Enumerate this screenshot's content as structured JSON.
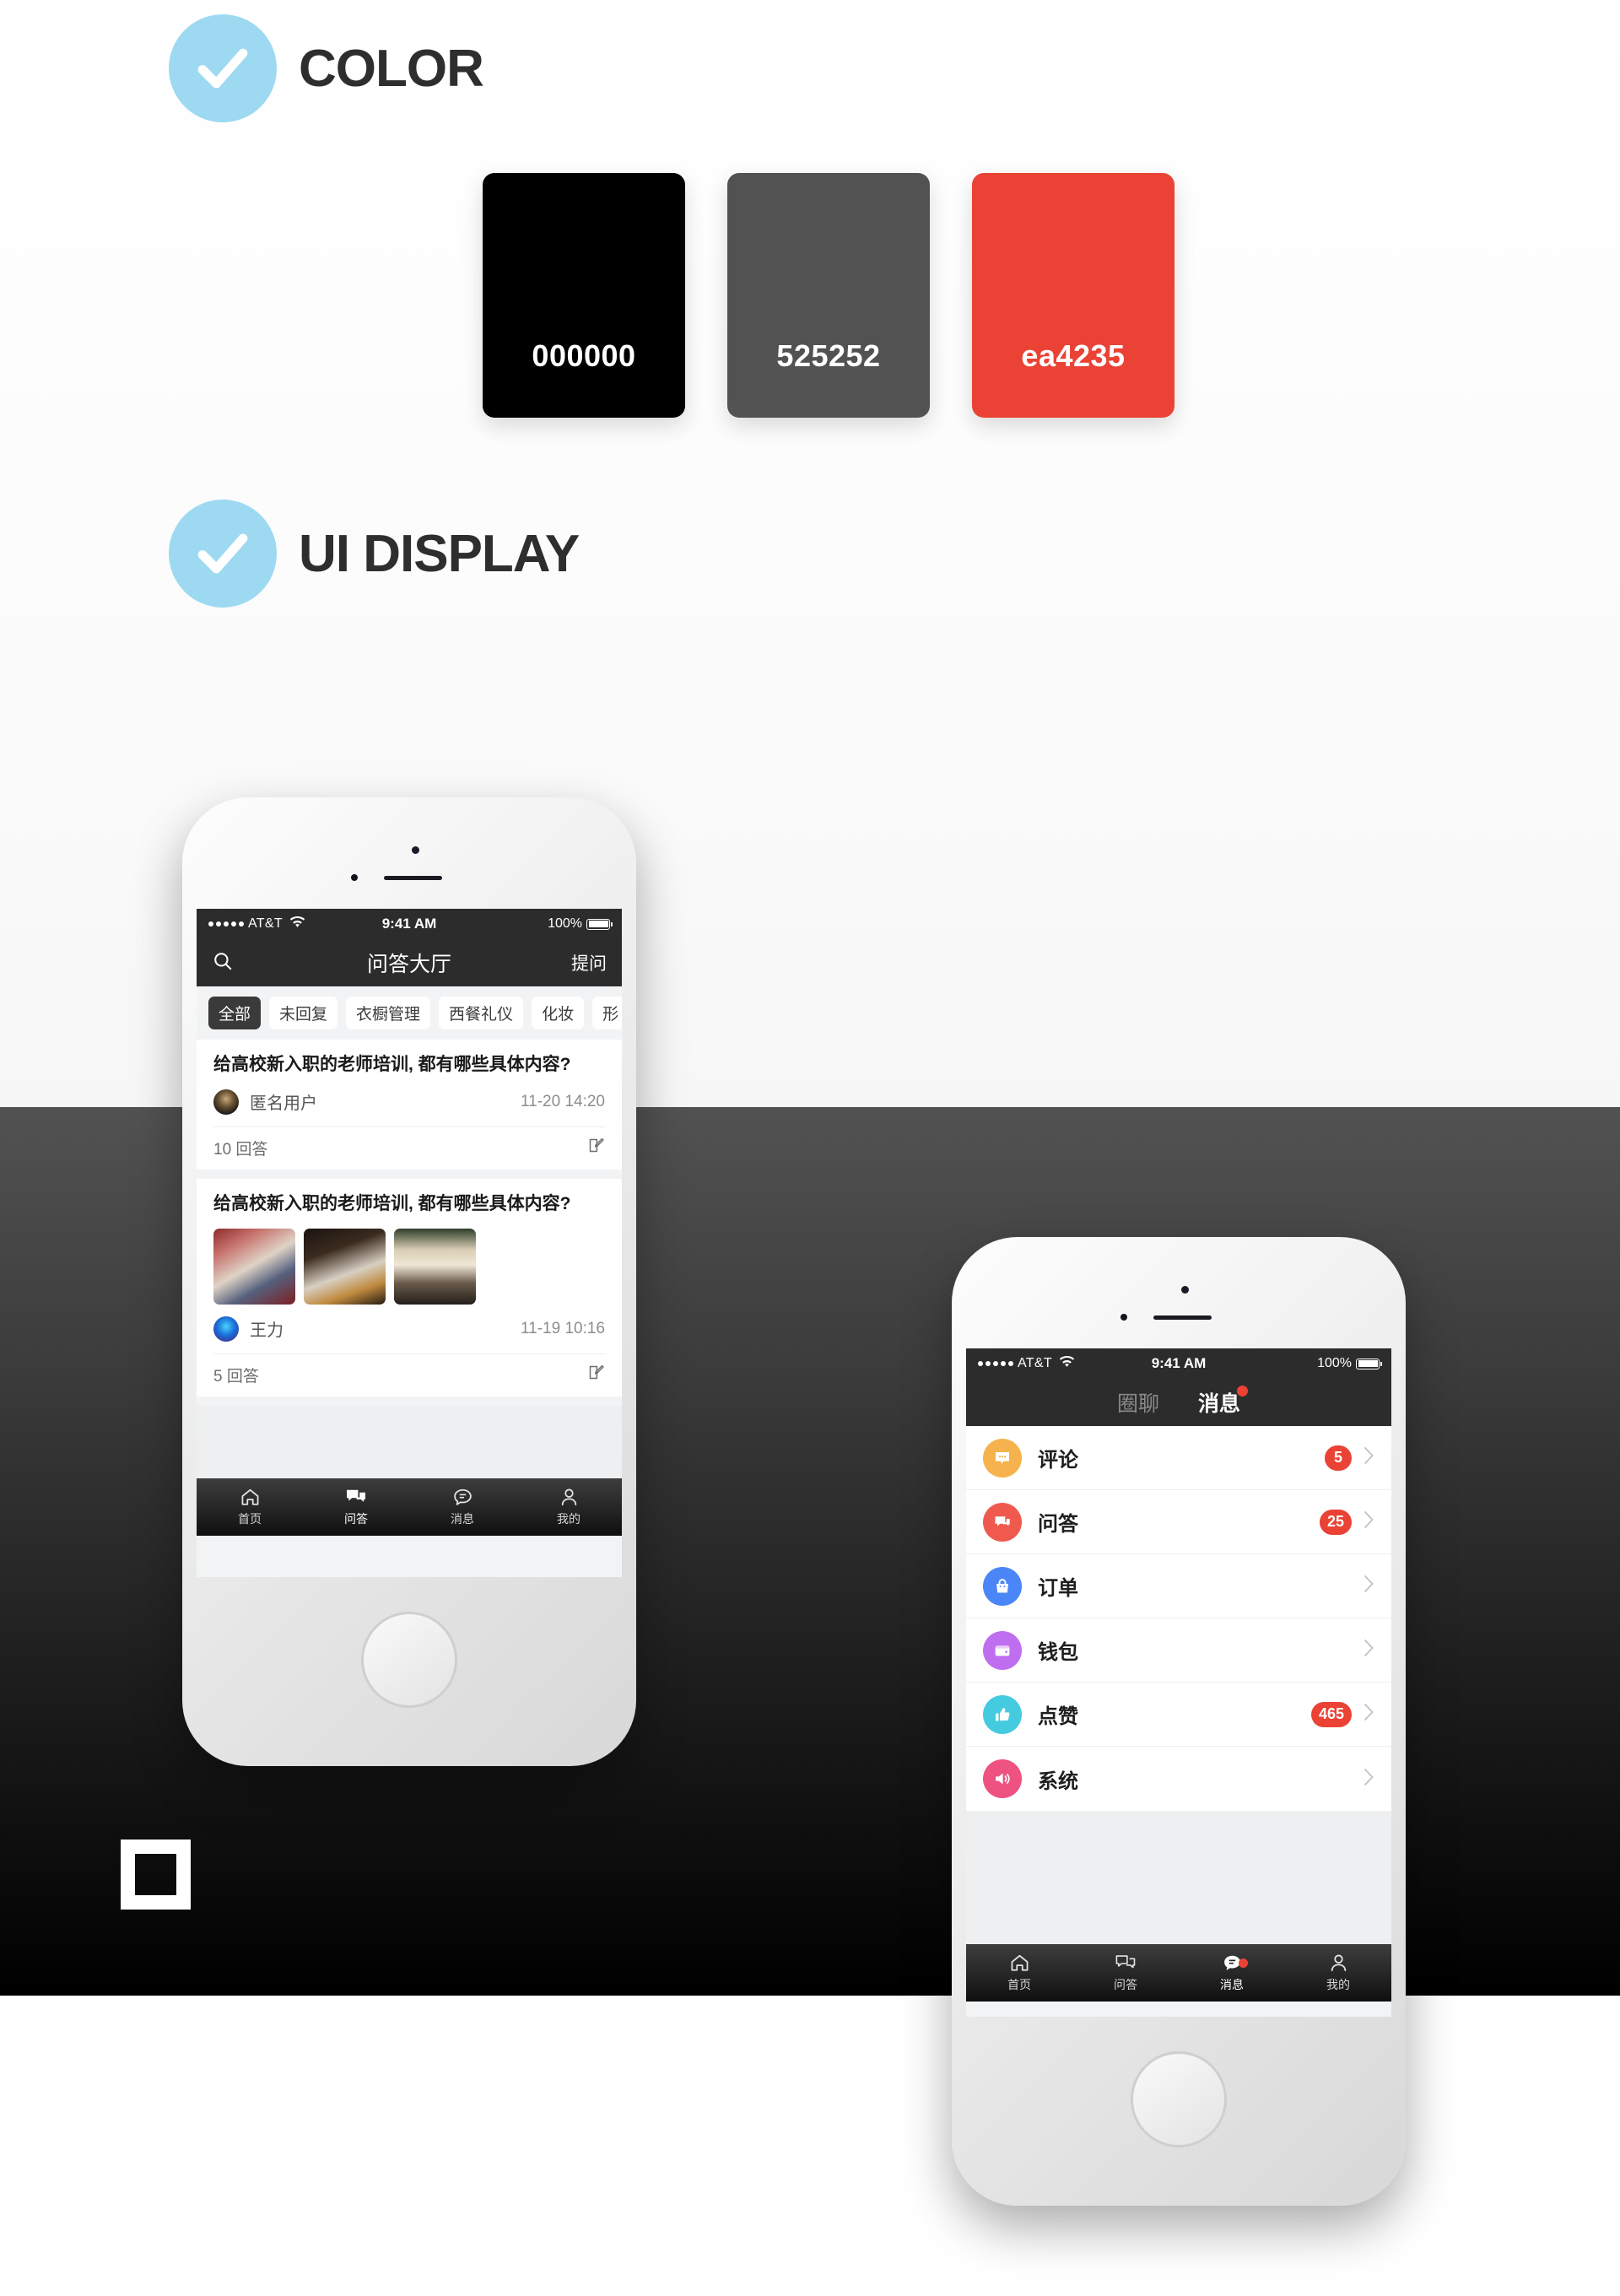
{
  "sections": {
    "color": {
      "title": "COLOR",
      "icon": "check-circle-icon"
    },
    "ui_display": {
      "title": "UI DISPLAY",
      "icon": "check-circle-icon"
    }
  },
  "palette": [
    {
      "hex": "#000000",
      "label": "000000"
    },
    {
      "hex": "#525252",
      "label": "525252"
    },
    {
      "hex": "#ea4235",
      "label": "ea4235"
    }
  ],
  "accent_blue": "#9ed9f2",
  "phone1": {
    "status_bar": {
      "carrier": "AT&T",
      "time": "9:41 AM",
      "battery": "100%"
    },
    "nav": {
      "title": "问答大厅",
      "action": "提问",
      "search_icon": "search-icon"
    },
    "chips": [
      {
        "label": "全部",
        "active": true
      },
      {
        "label": "未回复",
        "active": false
      },
      {
        "label": "衣橱管理",
        "active": false
      },
      {
        "label": "西餐礼仪",
        "active": false
      },
      {
        "label": "化妆",
        "active": false
      },
      {
        "label": "形",
        "active": false
      }
    ],
    "cards": [
      {
        "title": "给高校新入职的老师培训, 都有哪些具体内容?",
        "user": "匿名用户",
        "time": "11-20 14:20",
        "answers": "10 回答",
        "has_images": false
      },
      {
        "title": "给高校新入职的老师培训, 都有哪些具体内容?",
        "user": "王力",
        "time": "11-19 10:16",
        "answers": "5 回答",
        "has_images": true
      }
    ],
    "tabbar": [
      {
        "label": "首页",
        "icon": "home-icon",
        "active": false,
        "badge": false
      },
      {
        "label": "问答",
        "icon": "qa-chat-icon",
        "active": true,
        "badge": false
      },
      {
        "label": "消息",
        "icon": "message-icon",
        "active": false,
        "badge": false
      },
      {
        "label": "我的",
        "icon": "person-icon",
        "active": false,
        "badge": false
      }
    ]
  },
  "phone2": {
    "status_bar": {
      "carrier": "AT&T",
      "time": "9:41 AM",
      "battery": "100%"
    },
    "nav_tabs": [
      {
        "label": "圈聊",
        "active": false,
        "badge": false
      },
      {
        "label": "消息",
        "active": true,
        "badge": true
      }
    ],
    "rows": [
      {
        "label": "评论",
        "icon": "comment-bubble-icon",
        "color": "#f6b24c",
        "badge": "5"
      },
      {
        "label": "问答",
        "icon": "qa-bubble-icon",
        "color": "#f05a4e",
        "badge": "25"
      },
      {
        "label": "订单",
        "icon": "bag-icon",
        "color": "#4a86f7",
        "badge": ""
      },
      {
        "label": "钱包",
        "icon": "wallet-icon",
        "color": "#c06ef0",
        "badge": ""
      },
      {
        "label": "点赞",
        "icon": "thumbs-up-icon",
        "color": "#45cbe0",
        "badge": "465"
      },
      {
        "label": "系统",
        "icon": "speaker-icon",
        "color": "#ed5280",
        "badge": ""
      }
    ],
    "tabbar": [
      {
        "label": "首页",
        "icon": "home-icon",
        "active": false,
        "badge": false
      },
      {
        "label": "问答",
        "icon": "qa-chat-icon",
        "active": false,
        "badge": false
      },
      {
        "label": "消息",
        "icon": "message-icon",
        "active": true,
        "badge": true
      },
      {
        "label": "我的",
        "icon": "person-icon",
        "active": false,
        "badge": false
      }
    ]
  }
}
